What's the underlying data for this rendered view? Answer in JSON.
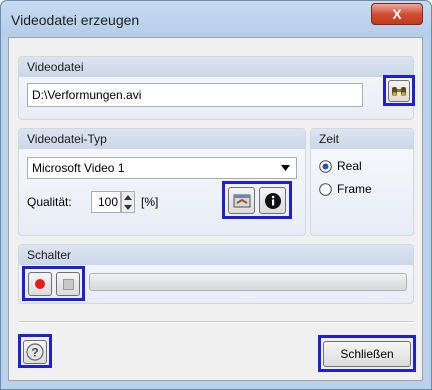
{
  "window": {
    "title": "Videodatei erzeugen",
    "close_label": "X"
  },
  "videodatei": {
    "group_label": "Videodatei",
    "path_value": "D:\\Verformungen.avi"
  },
  "videotyp": {
    "group_label": "Videodatei-Typ",
    "codec_selected": "Microsoft Video 1",
    "quality_label": "Qualität:",
    "quality_value": "100",
    "quality_unit": "[%]"
  },
  "zeit": {
    "group_label": "Zeit",
    "options": [
      {
        "label": "Real",
        "selected": true
      },
      {
        "label": "Frame",
        "selected": false
      }
    ]
  },
  "schalter": {
    "group_label": "Schalter",
    "progress": 0.0
  },
  "footer": {
    "close_button_label": "Schließen"
  },
  "colors": {
    "highlight": "#1f1fd6",
    "record_red": "#e31b1b",
    "accent_blue": "#1f1fd6"
  }
}
